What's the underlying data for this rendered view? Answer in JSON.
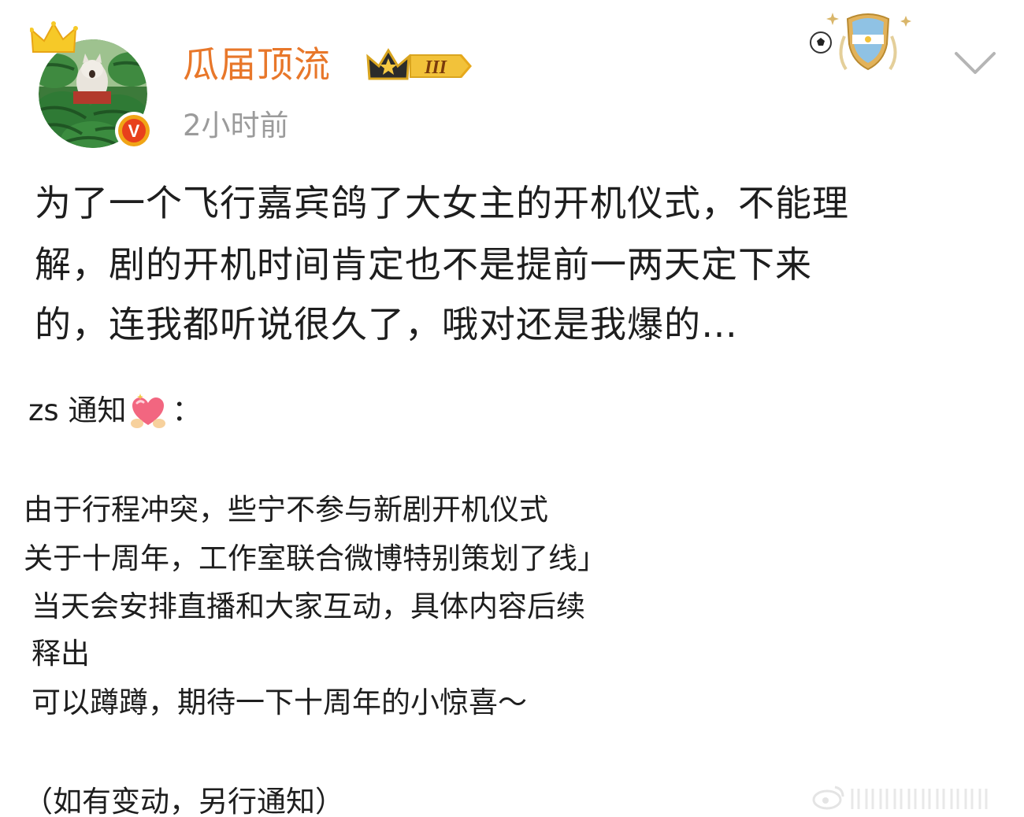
{
  "post": {
    "author": {
      "name": "瓜届顶流",
      "vip_level": "III",
      "verified_mark": "V"
    },
    "timestamp": "2小时前",
    "body_lines": [
      "为了一个飞行嘉宾鸽了大女主的开机仪式，不能理",
      "解，剧的开机时间肯定也不是提前一两天定下来",
      "的，连我都听说很久了，哦对还是我爆的…"
    ],
    "quoted_image": {
      "notice_prefix": "zs 通知",
      "notice_suffix": "：",
      "lines": [
        "由于行程冲突，些宁不参与新剧开机仪式",
        "关于十周年，工作室联合微博特别策划了线」",
        "当天会安排直播和大家互动，具体内容后续",
        "释出",
        "可以蹲蹲，期待一下十周年的小惊喜～",
        "（如有变动，另行通知）"
      ]
    }
  },
  "icons": {
    "crown": "crown-icon",
    "verified": "verified-badge-icon",
    "vip": "vip-crown-badge-icon",
    "medal": "argentina-shield-medal-icon",
    "menu": "chevron-down-icon",
    "heart": "heart-hands-icon"
  },
  "colors": {
    "username": "#e8772a",
    "timestamp": "#9b9b9b",
    "text": "#1e1e1e",
    "verified": "#f0a516"
  }
}
